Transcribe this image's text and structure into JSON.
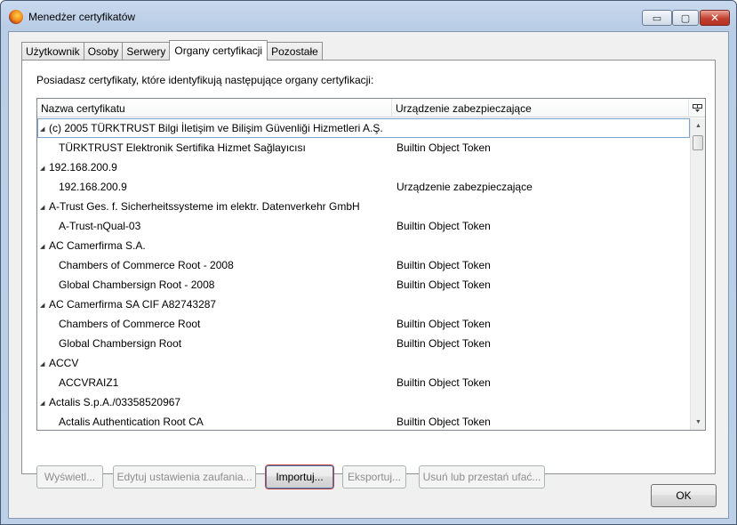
{
  "window": {
    "title": "Menedżer certyfikatów",
    "controls": {
      "minimize": "▭",
      "maximize": "▢",
      "close": "✕"
    }
  },
  "tabs": [
    {
      "label": "Użytkownik",
      "active": false
    },
    {
      "label": "Osoby",
      "active": false
    },
    {
      "label": "Serwery",
      "active": false
    },
    {
      "label": "Organy certyfikacji",
      "active": true
    },
    {
      "label": "Pozostałe",
      "active": false
    }
  ],
  "panel": {
    "intro": "Posiadasz certyfikaty, które identyfikują następujące organy certyfikacji:"
  },
  "tree": {
    "columns": {
      "name": "Nazwa certyfikatu",
      "device": "Urządzenie zabezpieczające",
      "picker_icon": "column-picker-icon"
    },
    "rows": [
      {
        "type": "group",
        "name": "(c) 2005 TÜRKTRUST Bilgi İletişim ve Bilişim Güvenliği Hizmetleri A.Ş.",
        "device": ""
      },
      {
        "type": "child",
        "name": "TÜRKTRUST Elektronik Sertifika Hizmet Sağlayıcısı",
        "device": "Builtin Object Token"
      },
      {
        "type": "group",
        "name": "192.168.200.9",
        "device": ""
      },
      {
        "type": "child",
        "name": "192.168.200.9",
        "device": "Urządzenie zabezpieczające"
      },
      {
        "type": "group",
        "name": "A-Trust Ges. f. Sicherheitssysteme im elektr. Datenverkehr GmbH",
        "device": ""
      },
      {
        "type": "child",
        "name": "A-Trust-nQual-03",
        "device": "Builtin Object Token"
      },
      {
        "type": "group",
        "name": "AC Camerfirma S.A.",
        "device": ""
      },
      {
        "type": "child",
        "name": "Chambers of Commerce Root - 2008",
        "device": "Builtin Object Token"
      },
      {
        "type": "child",
        "name": "Global Chambersign Root - 2008",
        "device": "Builtin Object Token"
      },
      {
        "type": "group",
        "name": "AC Camerfirma SA CIF A82743287",
        "device": ""
      },
      {
        "type": "child",
        "name": "Chambers of Commerce Root",
        "device": "Builtin Object Token"
      },
      {
        "type": "child",
        "name": "Global Chambersign Root",
        "device": "Builtin Object Token"
      },
      {
        "type": "group",
        "name": "ACCV",
        "device": ""
      },
      {
        "type": "child",
        "name": "ACCVRAIZ1",
        "device": "Builtin Object Token"
      },
      {
        "type": "group",
        "name": "Actalis S.p.A./03358520967",
        "device": ""
      },
      {
        "type": "child",
        "name": "Actalis Authentication Root CA",
        "device": "Builtin Object Token"
      }
    ]
  },
  "buttons": {
    "view": "Wyświetl...",
    "edit_trust": "Edytuj ustawienia zaufania...",
    "import": "Importuj...",
    "export": "Eksportuj...",
    "delete": "Usuń lub przestań ufać...",
    "ok": "OK"
  }
}
